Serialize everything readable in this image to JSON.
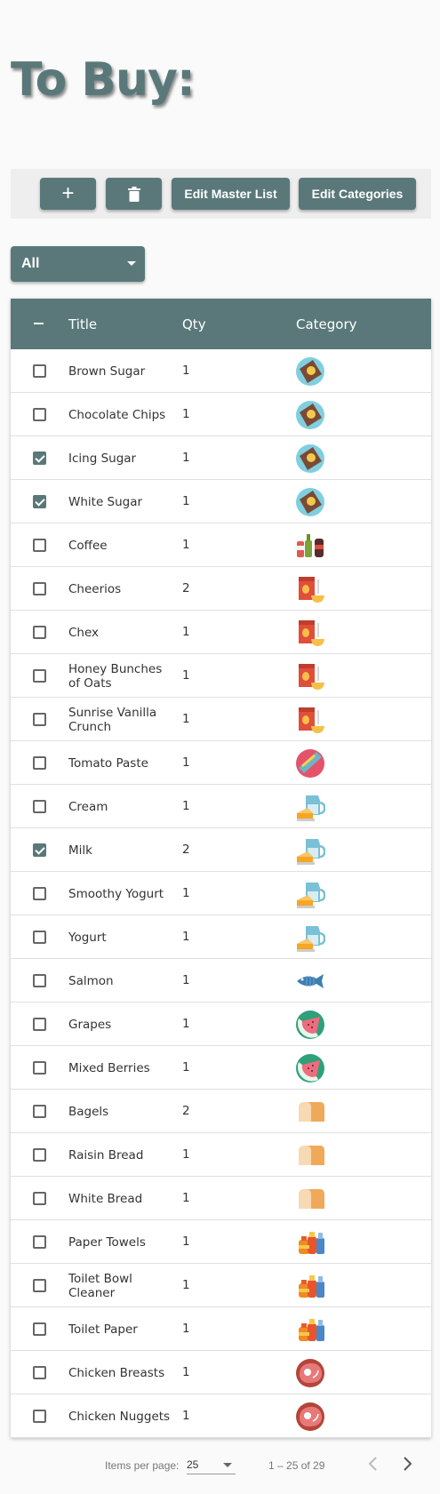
{
  "page": {
    "title": "To Buy:"
  },
  "toolbar": {
    "add_label": "+",
    "delete_icon": "trash-icon",
    "edit_master_label": "Edit Master List",
    "edit_categories_label": "Edit Categories"
  },
  "filter": {
    "value": "All"
  },
  "table": {
    "headers": {
      "select": "−",
      "title": "Title",
      "qty": "Qty",
      "category": "Category"
    },
    "rows": [
      {
        "title": "Brown Sugar",
        "qty": "1",
        "checked": false,
        "category_icon": "sugar"
      },
      {
        "title": "Chocolate Chips",
        "qty": "1",
        "checked": false,
        "category_icon": "sugar"
      },
      {
        "title": "Icing Sugar",
        "qty": "1",
        "checked": true,
        "category_icon": "sugar"
      },
      {
        "title": "White Sugar",
        "qty": "1",
        "checked": true,
        "category_icon": "sugar"
      },
      {
        "title": "Coffee",
        "qty": "1",
        "checked": false,
        "category_icon": "beverages"
      },
      {
        "title": "Cheerios",
        "qty": "2",
        "checked": false,
        "category_icon": "cereal"
      },
      {
        "title": "Chex",
        "qty": "1",
        "checked": false,
        "category_icon": "cereal"
      },
      {
        "title": "Honey Bunches of Oats",
        "qty": "1",
        "checked": false,
        "category_icon": "cereal"
      },
      {
        "title": "Sunrise Vanilla Crunch",
        "qty": "1",
        "checked": false,
        "category_icon": "cereal"
      },
      {
        "title": "Tomato Paste",
        "qty": "1",
        "checked": false,
        "category_icon": "canned"
      },
      {
        "title": "Cream",
        "qty": "1",
        "checked": false,
        "category_icon": "dairy"
      },
      {
        "title": "Milk",
        "qty": "2",
        "checked": true,
        "category_icon": "dairy"
      },
      {
        "title": "Smoothy Yogurt",
        "qty": "1",
        "checked": false,
        "category_icon": "dairy"
      },
      {
        "title": "Yogurt",
        "qty": "1",
        "checked": false,
        "category_icon": "dairy"
      },
      {
        "title": "Salmon",
        "qty": "1",
        "checked": false,
        "category_icon": "fish"
      },
      {
        "title": "Grapes",
        "qty": "1",
        "checked": false,
        "category_icon": "fruit"
      },
      {
        "title": "Mixed Berries",
        "qty": "1",
        "checked": false,
        "category_icon": "fruit"
      },
      {
        "title": "Bagels",
        "qty": "2",
        "checked": false,
        "category_icon": "bread"
      },
      {
        "title": "Raisin Bread",
        "qty": "1",
        "checked": false,
        "category_icon": "bread"
      },
      {
        "title": "White Bread",
        "qty": "1",
        "checked": false,
        "category_icon": "bread"
      },
      {
        "title": "Paper Towels",
        "qty": "1",
        "checked": false,
        "category_icon": "household"
      },
      {
        "title": "Toilet Bowl Cleaner",
        "qty": "1",
        "checked": false,
        "category_icon": "household"
      },
      {
        "title": "Toilet Paper",
        "qty": "1",
        "checked": false,
        "category_icon": "household"
      },
      {
        "title": "Chicken Breasts",
        "qty": "1",
        "checked": false,
        "category_icon": "meat"
      },
      {
        "title": "Chicken Nuggets",
        "qty": "1",
        "checked": false,
        "category_icon": "meat"
      }
    ]
  },
  "paginator": {
    "items_per_page_label": "Items per page:",
    "page_size": "25",
    "range_label": "1 – 25 of 29"
  },
  "colors": {
    "primary": "#5a7879",
    "header_bg": "#5a7879",
    "toolbar_bg": "#eeeeee"
  }
}
